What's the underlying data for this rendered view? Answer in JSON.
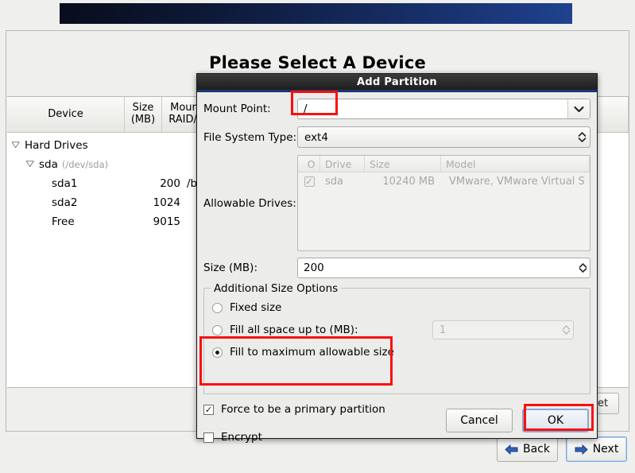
{
  "background": {
    "page_title": "Please Select A Device",
    "table": {
      "headers": {
        "device": "Device",
        "size": "Size\n(MB)",
        "size_line1": "Size",
        "size_line2": "(MB)",
        "mount_line1": "Mount",
        "mount_line2": "RAID/V",
        "format": ""
      },
      "rows": [
        {
          "indent": 0,
          "twisty": "▽",
          "name": "Hard Drives",
          "detail": "",
          "size": "",
          "mount": ""
        },
        {
          "indent": 1,
          "twisty": "▽",
          "name": "sda",
          "detail": "(/dev/sda)",
          "size": "",
          "mount": ""
        },
        {
          "indent": 2,
          "twisty": "",
          "name": "sda1",
          "detail": "",
          "size": "200",
          "mount": "/boot"
        },
        {
          "indent": 2,
          "twisty": "",
          "name": "sda2",
          "detail": "",
          "size": "1024",
          "mount": ""
        },
        {
          "indent": 2,
          "twisty": "",
          "name": "Free",
          "detail": "",
          "size": "9015",
          "mount": ""
        }
      ]
    },
    "reset_button": "Reset",
    "back_button": "Back",
    "next_button": "Next"
  },
  "dialog": {
    "title": "Add Partition",
    "mount_point": {
      "label": "Mount Point:",
      "value": "/",
      "icon": "chevron-down-icon"
    },
    "file_system_type": {
      "label": "File System Type:",
      "value": "ext4",
      "icon": "spinner-updown-icon"
    },
    "allowable_drives": {
      "label": "Allowable Drives:",
      "headers": [
        "O",
        "Drive",
        "Size",
        "Model"
      ],
      "rows": [
        {
          "checked": true,
          "drive": "sda",
          "size": "10240 MB",
          "model": "VMware, VMware Virtual S"
        }
      ]
    },
    "size": {
      "label": "Size (MB):",
      "value": "200"
    },
    "additional_size_options": {
      "legend": "Additional Size Options",
      "options": [
        {
          "label": "Fixed size",
          "selected": false
        },
        {
          "label": "Fill all space up to (MB):",
          "selected": false,
          "spinner_value": "1",
          "spinner_disabled": true
        },
        {
          "label": "Fill to maximum allowable size",
          "selected": true
        }
      ]
    },
    "force_primary": {
      "label": "Force to be a primary partition",
      "checked": true
    },
    "encrypt": {
      "label": "Encrypt",
      "checked": false
    },
    "cancel_button": "Cancel",
    "ok_button": "OK"
  },
  "colors": {
    "highlight": "#fb0f0f",
    "banner_start": "#080d1c",
    "banner_end": "#20438f",
    "dialog_titlebar": "#2b2b2b",
    "dialog_body": "#ececea",
    "focus_blue": "#8aa8ce"
  },
  "glyphs": {
    "check": "✓",
    "chevron_down": "⌄",
    "arrow_up": "▲",
    "arrow_down": "▼"
  }
}
